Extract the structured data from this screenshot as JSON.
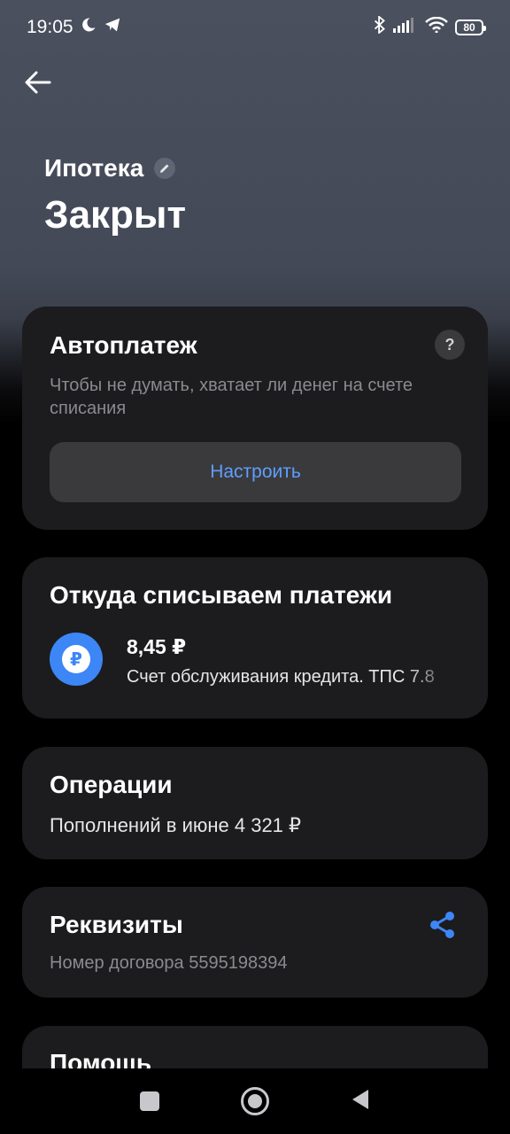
{
  "status_bar": {
    "time": "19:05",
    "battery": "80",
    "icons": [
      "moon-icon",
      "telegram-icon",
      "bluetooth-icon",
      "signal-icon",
      "wifi-icon",
      "battery-icon"
    ]
  },
  "header": {
    "product": "Ипотека",
    "status": "Закрыт"
  },
  "autopay": {
    "title": "Автоплатеж",
    "description": "Чтобы не думать, хватает ли денег на счете списания",
    "help_label": "?",
    "setup_label": "Настроить"
  },
  "source": {
    "title": "Откуда списываем платежи",
    "amount": "8,45 ₽",
    "account_name": "Счет обслуживания кредита. ТПС 7.8",
    "currency_symbol": "₽"
  },
  "operations": {
    "title": "Операции",
    "summary": "Пополнений в июне 4 321 ₽"
  },
  "requisites": {
    "title": "Реквизиты",
    "contract": "Номер договора 5595198394"
  },
  "help": {
    "title": "Помощь"
  },
  "colors": {
    "accent": "#5e9eff",
    "ruble_badge": "#3d86f5",
    "card_bg": "#1c1c1e",
    "button_bg": "#3a3a3c"
  }
}
